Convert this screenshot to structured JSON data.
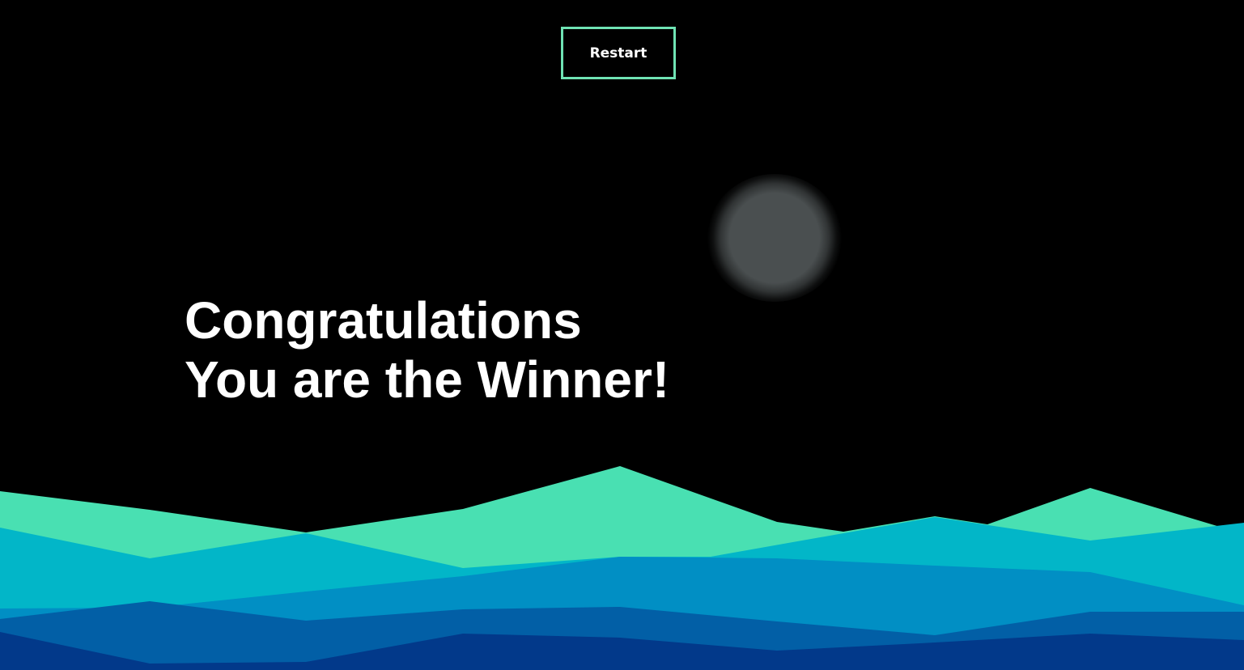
{
  "restart_button": {
    "label": "Restart"
  },
  "message": {
    "line1": "Congratulations",
    "line2": "You are the Winner!"
  },
  "colors": {
    "background": "#000000",
    "accent": "#6fe3b4",
    "wave_1": "#49e0b2",
    "wave_2": "#02b6c8",
    "wave_3": "#018fc4",
    "wave_4": "#025fa6",
    "wave_5": "#02398a",
    "moon": "#4a4f50"
  }
}
